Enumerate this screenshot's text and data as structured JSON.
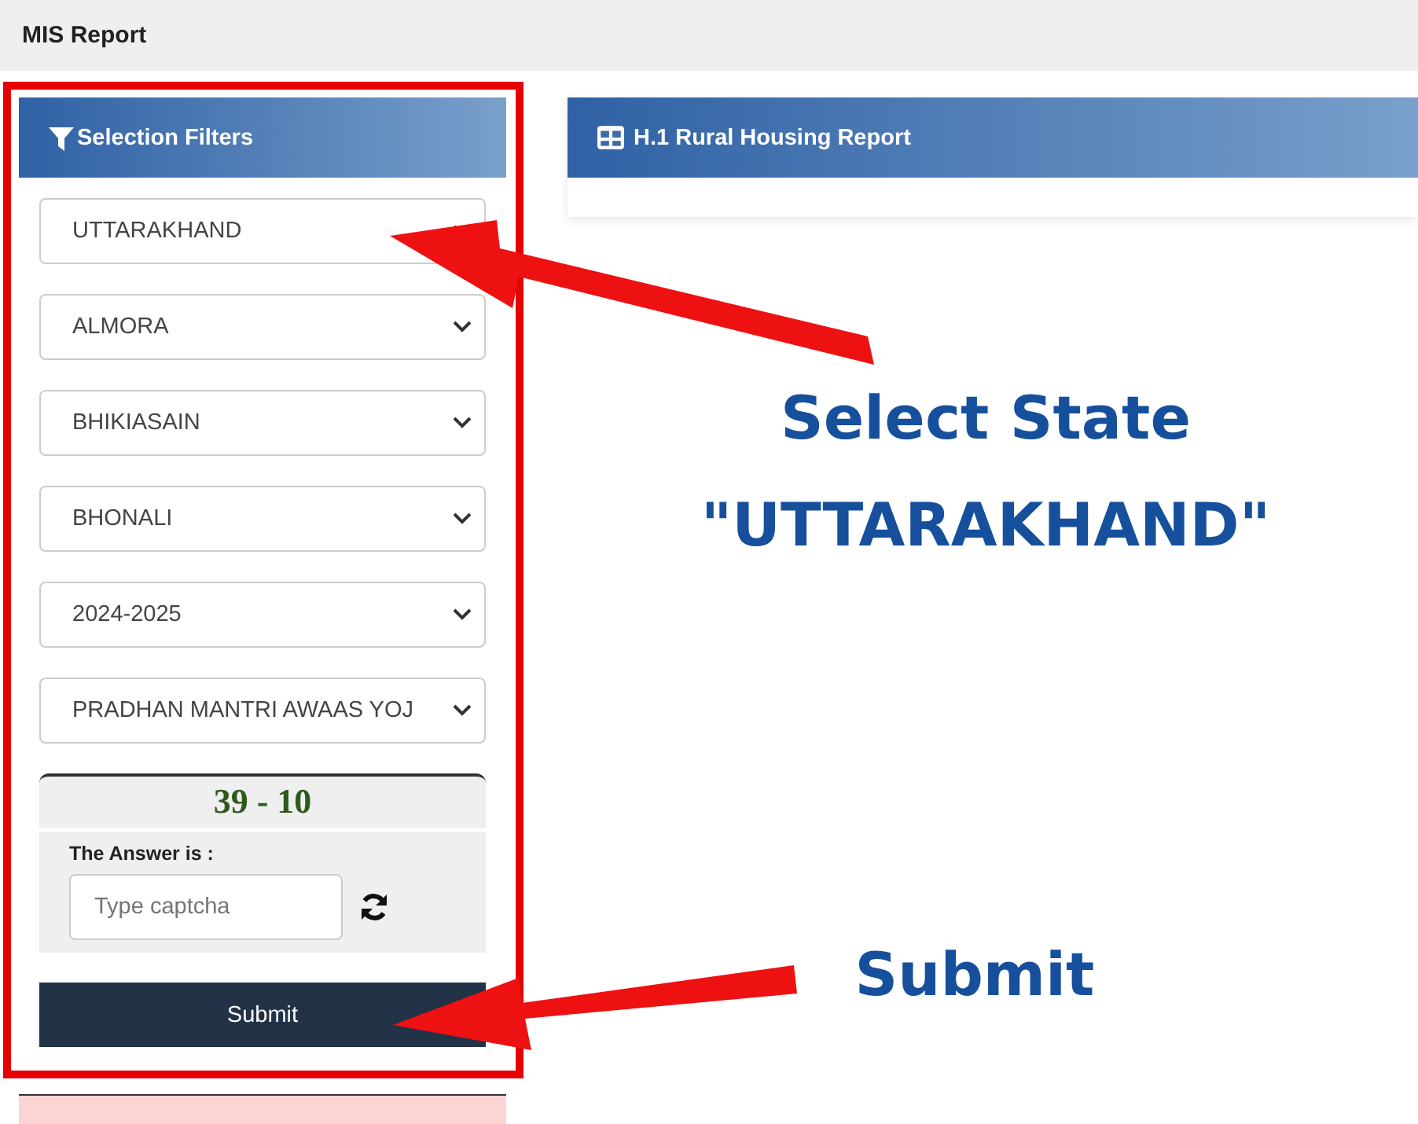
{
  "header": {
    "title": "MIS Report"
  },
  "filters": {
    "title": "Selection Filters",
    "selects": [
      {
        "value": "UTTARAKHAND"
      },
      {
        "value": "ALMORA"
      },
      {
        "value": "BHIKIASAIN"
      },
      {
        "value": "BHONALI"
      },
      {
        "value": "2024-2025"
      },
      {
        "value": "PRADHAN MANTRI AWAAS YOJ"
      }
    ],
    "captcha": {
      "question": "39 - 10",
      "label": "The Answer is :",
      "placeholder": "Type captcha"
    },
    "submit": "Submit"
  },
  "report": {
    "title": "H.1 Rural Housing Report"
  },
  "annotations": [
    {
      "lines": [
        "Select State",
        "\"UTTARAKHAND\""
      ]
    },
    {
      "lines": [
        "Submit"
      ]
    }
  ]
}
